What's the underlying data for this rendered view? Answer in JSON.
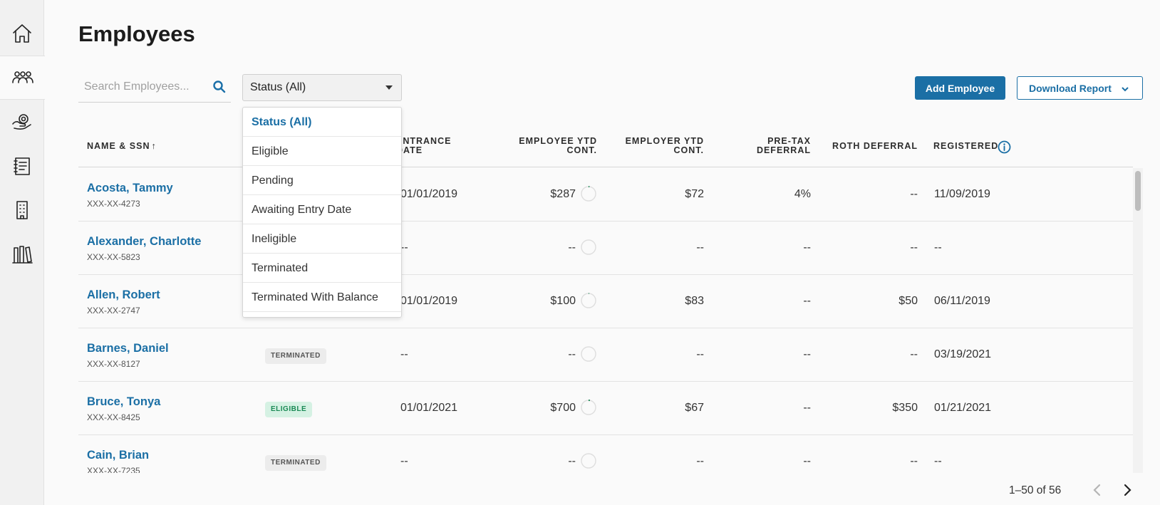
{
  "page": {
    "title": "Employees"
  },
  "sidebar": {
    "items": [
      {
        "icon": "home-icon",
        "active": false
      },
      {
        "icon": "people-icon",
        "active": true
      },
      {
        "icon": "hand-coin-icon",
        "active": false
      },
      {
        "icon": "ledger-icon",
        "active": false
      },
      {
        "icon": "building-icon",
        "active": false
      },
      {
        "icon": "library-icon",
        "active": false
      }
    ]
  },
  "search": {
    "placeholder": "Search Employees..."
  },
  "status_filter": {
    "value": "Status (All)",
    "options": [
      "Status (All)",
      "Eligible",
      "Pending",
      "Awaiting Entry Date",
      "Ineligible",
      "Terminated",
      "Terminated With Balance"
    ]
  },
  "toolbar": {
    "add_label": "Add Employee",
    "download_label": "Download Report"
  },
  "table": {
    "headers": {
      "name": "Name & SSN",
      "sort_arrow": "↑",
      "entrance_line1": "Entrance",
      "entrance_line2": "Date",
      "employee_line1": "Employee YTD",
      "employee_line2": "Cont.",
      "employer_line1": "Employer YTD",
      "employer_line2": "Cont.",
      "pretax_line1": "Pre-Tax",
      "pretax_line2": "Deferral",
      "roth": "Roth Deferral",
      "registered": "Registered"
    },
    "rows": [
      {
        "name": "Acosta, Tammy",
        "ssn": "XXX-XX-4273",
        "status": "",
        "entrance": "01/01/2019",
        "employee_ytd": "$287",
        "employer_ytd": "$72",
        "pretax": "4%",
        "roth": "--",
        "registered": "11/09/2019",
        "progress": 0.02
      },
      {
        "name": "Alexander, Charlotte",
        "ssn": "XXX-XX-5823",
        "status": "",
        "entrance": "--",
        "employee_ytd": "--",
        "employer_ytd": "--",
        "pretax": "--",
        "roth": "--",
        "registered": "--",
        "progress": 0
      },
      {
        "name": "Allen, Robert",
        "ssn": "XXX-XX-2747",
        "status": "",
        "entrance": "01/01/2019",
        "employee_ytd": "$100",
        "employer_ytd": "$83",
        "pretax": "--",
        "roth": "$50",
        "registered": "06/11/2019",
        "progress": 0.01
      },
      {
        "name": "Barnes, Daniel",
        "ssn": "XXX-XX-8127",
        "status": "TERMINATED",
        "entrance": "--",
        "employee_ytd": "--",
        "employer_ytd": "--",
        "pretax": "--",
        "roth": "--",
        "registered": "03/19/2021",
        "progress": 0
      },
      {
        "name": "Bruce, Tonya",
        "ssn": "XXX-XX-8425",
        "status": "ELIGIBLE",
        "entrance": "01/01/2021",
        "employee_ytd": "$700",
        "employer_ytd": "$67",
        "pretax": "--",
        "roth": "$350",
        "registered": "01/21/2021",
        "progress": 0.03
      },
      {
        "name": "Cain, Brian",
        "ssn": "XXX-XX-7235",
        "status": "TERMINATED",
        "entrance": "--",
        "employee_ytd": "--",
        "employer_ytd": "--",
        "pretax": "--",
        "roth": "--",
        "registered": "--",
        "progress": 0
      }
    ]
  },
  "pagination": {
    "range": "1–50 of 56"
  },
  "colors": {
    "accent": "#1b6fa5",
    "eligible": "#1a8a55",
    "progress": "#1a8a55"
  }
}
